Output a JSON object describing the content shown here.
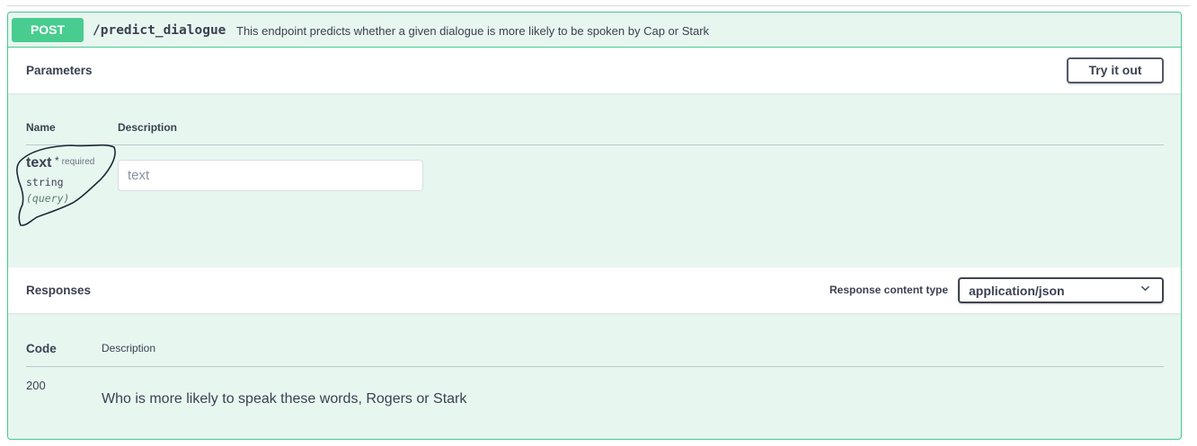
{
  "operation": {
    "method": "POST",
    "path": "/predict_dialogue",
    "summary": "This endpoint predicts whether a given dialogue is more likely to be spoken by Cap or Stark"
  },
  "parameters": {
    "title": "Parameters",
    "try_it_out_label": "Try it out",
    "columns": {
      "name": "Name",
      "description": "Description"
    },
    "items": [
      {
        "name": "text",
        "required_mark": "*",
        "required_label": "required",
        "type": "string",
        "in": "(query)",
        "input_placeholder": "text"
      }
    ]
  },
  "responses": {
    "title": "Responses",
    "content_type_label": "Response content type",
    "content_type_value": "application/json",
    "columns": {
      "code": "Code",
      "description": "Description"
    },
    "items": [
      {
        "code": "200",
        "description": "Who is more likely to speak these words, Rogers or Stark"
      }
    ]
  },
  "colors": {
    "post_accent": "#49cc90",
    "block_background": "#e8f6f0",
    "text": "#3b4151"
  },
  "icons": {
    "select_arrow": "chevron-down-icon"
  }
}
